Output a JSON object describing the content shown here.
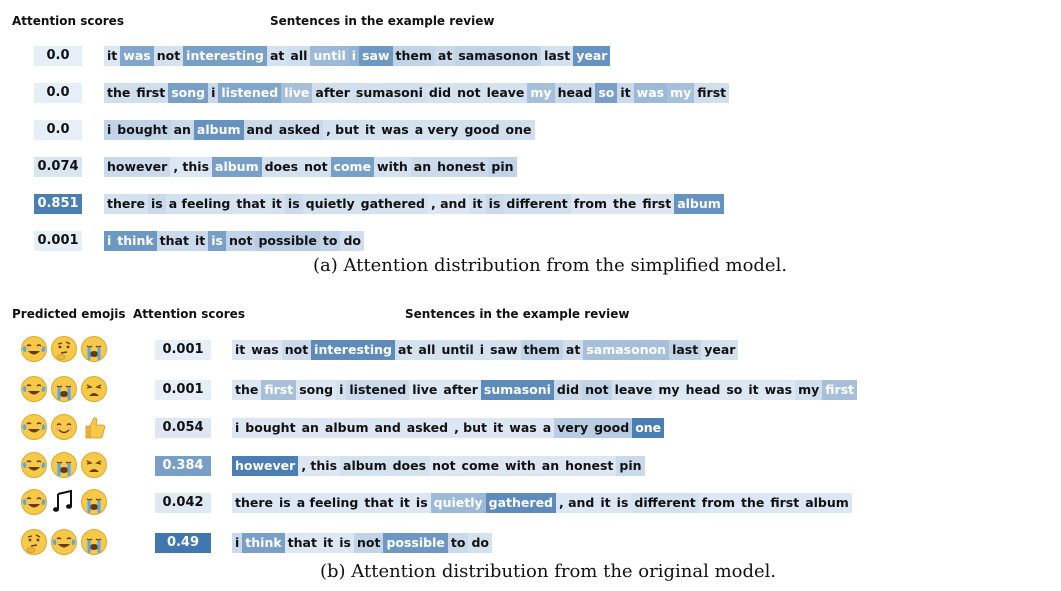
{
  "panel_a": {
    "header_scores": "Attention scores",
    "header_sentences": "Sentences in the example review",
    "caption": "(a)  Attention distribution from the simplified model.",
    "rows": [
      {
        "score": "0.0",
        "score_weight": 0.0,
        "tokens": [
          {
            "t": "it",
            "w": 0.05
          },
          {
            "t": "was",
            "w": 0.55
          },
          {
            "t": "not",
            "w": 0.1
          },
          {
            "t": "interesting",
            "w": 0.6
          },
          {
            "t": "at",
            "w": 0.1
          },
          {
            "t": "all",
            "w": 0.12
          },
          {
            "t": "until",
            "w": 0.4
          },
          {
            "t": "i",
            "w": 0.45
          },
          {
            "t": "saw",
            "w": 0.65
          },
          {
            "t": "them",
            "w": 0.2
          },
          {
            "t": "at",
            "w": 0.15
          },
          {
            "t": "samasonon",
            "w": 0.2
          },
          {
            "t": "last",
            "w": 0.1
          },
          {
            "t": "year",
            "w": 0.7
          }
        ]
      },
      {
        "score": "0.0",
        "score_weight": 0.0,
        "tokens": [
          {
            "t": "the",
            "w": 0.12
          },
          {
            "t": "first",
            "w": 0.12
          },
          {
            "t": "song",
            "w": 0.6
          },
          {
            "t": "i",
            "w": 0.15
          },
          {
            "t": "listened",
            "w": 0.55
          },
          {
            "t": "live",
            "w": 0.35
          },
          {
            "t": "after",
            "w": 0.12
          },
          {
            "t": "sumasoni",
            "w": 0.12
          },
          {
            "t": "did",
            "w": 0.1
          },
          {
            "t": "not",
            "w": 0.1
          },
          {
            "t": "leave",
            "w": 0.1
          },
          {
            "t": "my",
            "w": 0.35
          },
          {
            "t": "head",
            "w": 0.15
          },
          {
            "t": "so",
            "w": 0.6
          },
          {
            "t": "it",
            "w": 0.15
          },
          {
            "t": "was",
            "w": 0.4
          },
          {
            "t": "my",
            "w": 0.35
          },
          {
            "t": "first",
            "w": 0.12
          }
        ]
      },
      {
        "score": "0.0",
        "score_weight": 0.0,
        "tokens": [
          {
            "t": "i",
            "w": 0.2
          },
          {
            "t": "bought",
            "w": 0.2
          },
          {
            "t": "an",
            "w": 0.15
          },
          {
            "t": "album",
            "w": 0.7
          },
          {
            "t": "and",
            "w": 0.15
          },
          {
            "t": "asked",
            "w": 0.15
          },
          {
            "t": ", but",
            "w": 0.1
          },
          {
            "t": "it",
            "w": 0.1
          },
          {
            "t": "was",
            "w": 0.1
          },
          {
            "t": "a very",
            "w": 0.1
          },
          {
            "t": "good",
            "w": 0.12
          },
          {
            "t": "one",
            "w": 0.12
          }
        ]
      },
      {
        "score": "0.074",
        "score_weight": 0.07,
        "tokens": [
          {
            "t": "however",
            "w": 0.15
          },
          {
            "t": ", this",
            "w": 0.05
          },
          {
            "t": "album",
            "w": 0.6
          },
          {
            "t": "does",
            "w": 0.1
          },
          {
            "t": "not",
            "w": 0.1
          },
          {
            "t": "come",
            "w": 0.6
          },
          {
            "t": "with",
            "w": 0.1
          },
          {
            "t": "an",
            "w": 0.15
          },
          {
            "t": "honest",
            "w": 0.15
          },
          {
            "t": "pin",
            "w": 0.2
          }
        ]
      },
      {
        "score": "0.851",
        "score_weight": 0.85,
        "tokens": [
          {
            "t": "there",
            "w": 0.1
          },
          {
            "t": "is",
            "w": 0.15
          },
          {
            "t": "a feeling",
            "w": 0.1
          },
          {
            "t": "that",
            "w": 0.08
          },
          {
            "t": "it",
            "w": 0.1
          },
          {
            "t": "is",
            "w": 0.15
          },
          {
            "t": "quietly",
            "w": 0.1
          },
          {
            "t": "gathered",
            "w": 0.1
          },
          {
            "t": ", and",
            "w": 0.05
          },
          {
            "t": "it",
            "w": 0.1
          },
          {
            "t": "is",
            "w": 0.15
          },
          {
            "t": "different",
            "w": 0.12
          },
          {
            "t": "from",
            "w": 0.05
          },
          {
            "t": "the",
            "w": 0.05
          },
          {
            "t": "first",
            "w": 0.05
          },
          {
            "t": "album",
            "w": 0.7
          }
        ]
      },
      {
        "score": "0.001",
        "score_weight": 0.0,
        "tokens": [
          {
            "t": "i",
            "w": 0.65
          },
          {
            "t": "think",
            "w": 0.65
          },
          {
            "t": "that",
            "w": 0.15
          },
          {
            "t": "it",
            "w": 0.15
          },
          {
            "t": "is",
            "w": 0.6
          },
          {
            "t": "not",
            "w": 0.2
          },
          {
            "t": "possible",
            "w": 0.25
          },
          {
            "t": "to",
            "w": 0.2
          },
          {
            "t": "do",
            "w": 0.12
          }
        ]
      }
    ]
  },
  "panel_b": {
    "header_emojis": "Predicted emojis",
    "header_scores": "Attention scores",
    "header_sentences": "Sentences in the example review",
    "caption": "(b)  Attention distribution from the original model.",
    "rows": [
      {
        "emojis": [
          "face-with-tears-of-joy-icon",
          "thinking-face-icon",
          "loudly-crying-face-icon"
        ],
        "score": "0.001",
        "score_weight": 0.0,
        "tokens": [
          {
            "t": "it",
            "w": 0.05
          },
          {
            "t": "was",
            "w": 0.05
          },
          {
            "t": "not",
            "w": 0.15
          },
          {
            "t": "interesting",
            "w": 0.75
          },
          {
            "t": "at",
            "w": 0.1
          },
          {
            "t": "all",
            "w": 0.1
          },
          {
            "t": "until",
            "w": 0.1
          },
          {
            "t": "i",
            "w": 0.1
          },
          {
            "t": "saw",
            "w": 0.1
          },
          {
            "t": "them",
            "w": 0.2
          },
          {
            "t": "at",
            "w": 0.12
          },
          {
            "t": "samasonon",
            "w": 0.35
          },
          {
            "t": "last",
            "w": 0.2
          },
          {
            "t": "year",
            "w": 0.1
          }
        ]
      },
      {
        "emojis": [
          "face-with-tears-of-joy-icon",
          "loudly-crying-face-icon",
          "weary-face-icon"
        ],
        "score": "0.001",
        "score_weight": 0.0,
        "tokens": [
          {
            "t": "the",
            "w": 0.05
          },
          {
            "t": "first",
            "w": 0.35
          },
          {
            "t": "song",
            "w": 0.05
          },
          {
            "t": "i",
            "w": 0.1
          },
          {
            "t": "listened",
            "w": 0.15
          },
          {
            "t": "live",
            "w": 0.05
          },
          {
            "t": "after",
            "w": 0.05
          },
          {
            "t": "sumasoni",
            "w": 0.75
          },
          {
            "t": "did",
            "w": 0.15
          },
          {
            "t": "not",
            "w": 0.2
          },
          {
            "t": "leave",
            "w": 0.1
          },
          {
            "t": "my",
            "w": 0.05
          },
          {
            "t": "head",
            "w": 0.05
          },
          {
            "t": "so",
            "w": 0.05
          },
          {
            "t": "it",
            "w": 0.05
          },
          {
            "t": "was",
            "w": 0.05
          },
          {
            "t": "my",
            "w": 0.12
          },
          {
            "t": "first",
            "w": 0.35
          }
        ]
      },
      {
        "emojis": [
          "face-with-tears-of-joy-icon",
          "smiling-face-icon",
          "thumbs-up-icon"
        ],
        "score": "0.054",
        "score_weight": 0.05,
        "tokens": [
          {
            "t": "i",
            "w": 0.05
          },
          {
            "t": "bought",
            "w": 0.05
          },
          {
            "t": "an",
            "w": 0.05
          },
          {
            "t": "album",
            "w": 0.05
          },
          {
            "t": "and",
            "w": 0.05
          },
          {
            "t": "asked",
            "w": 0.05
          },
          {
            "t": ", but",
            "w": 0.05
          },
          {
            "t": "it",
            "w": 0.05
          },
          {
            "t": "was",
            "w": 0.05
          },
          {
            "t": "a",
            "w": 0.05
          },
          {
            "t": "very",
            "w": 0.25
          },
          {
            "t": "good",
            "w": 0.25
          },
          {
            "t": "one",
            "w": 0.85
          }
        ]
      },
      {
        "emojis": [
          "face-with-tears-of-joy-icon",
          "loudly-crying-face-icon",
          "weary-face-icon"
        ],
        "score": "0.384",
        "score_weight": 0.6,
        "tokens": [
          {
            "t": "however",
            "w": 0.85
          },
          {
            "t": ", this",
            "w": 0.05
          },
          {
            "t": "album",
            "w": 0.1
          },
          {
            "t": "does",
            "w": 0.1
          },
          {
            "t": "not",
            "w": 0.05
          },
          {
            "t": "come",
            "w": 0.05
          },
          {
            "t": "with",
            "w": 0.05
          },
          {
            "t": "an",
            "w": 0.05
          },
          {
            "t": "honest",
            "w": 0.05
          },
          {
            "t": "pin",
            "w": 0.15
          }
        ]
      },
      {
        "emojis": [
          "face-with-tears-of-joy-icon",
          "musical-notes-icon",
          "loudly-crying-face-icon"
        ],
        "score": "0.042",
        "score_weight": 0.04,
        "tokens": [
          {
            "t": "there",
            "w": 0.05
          },
          {
            "t": "is",
            "w": 0.05
          },
          {
            "t": "a feeling",
            "w": 0.05
          },
          {
            "t": "that",
            "w": 0.05
          },
          {
            "t": "it",
            "w": 0.05
          },
          {
            "t": "is",
            "w": 0.05
          },
          {
            "t": "quietly",
            "w": 0.4
          },
          {
            "t": "gathered",
            "w": 0.75
          },
          {
            "t": ", and",
            "w": 0.05
          },
          {
            "t": "it",
            "w": 0.05
          },
          {
            "t": "is",
            "w": 0.05
          },
          {
            "t": "different",
            "w": 0.1
          },
          {
            "t": "from",
            "w": 0.05
          },
          {
            "t": "the",
            "w": 0.05
          },
          {
            "t": "first",
            "w": 0.05
          },
          {
            "t": "album",
            "w": 0.05
          }
        ]
      },
      {
        "emojis": [
          "thinking-face-icon",
          "face-with-tears-of-joy-icon",
          "loudly-crying-face-icon"
        ],
        "score": "0.49",
        "score_weight": 0.9,
        "tokens": [
          {
            "t": "i",
            "w": 0.15
          },
          {
            "t": "think",
            "w": 0.6
          },
          {
            "t": "that",
            "w": 0.05
          },
          {
            "t": "it",
            "w": 0.05
          },
          {
            "t": "is",
            "w": 0.05
          },
          {
            "t": "not",
            "w": 0.2
          },
          {
            "t": "possible",
            "w": 0.65
          },
          {
            "t": "to",
            "w": 0.15
          },
          {
            "t": "do",
            "w": 0.1
          }
        ]
      }
    ]
  },
  "colors": {
    "light": "#e6eef7",
    "dark": "#2e6aa8",
    "text_dark": "#111111",
    "text_light": "#ffffff"
  }
}
